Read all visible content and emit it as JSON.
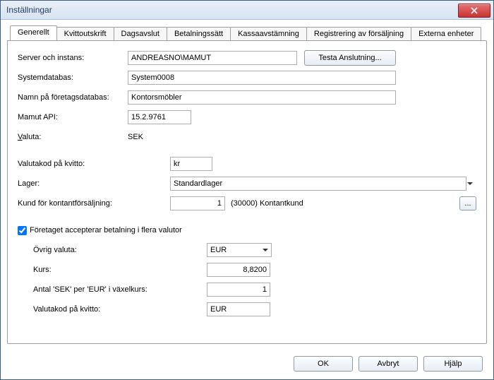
{
  "window": {
    "title": "Inställningar"
  },
  "tabs": [
    {
      "label": "Generellt",
      "active": true
    },
    {
      "label": "Kvittoutskrift"
    },
    {
      "label": "Dagsavslut"
    },
    {
      "label": "Betalningssätt"
    },
    {
      "label": "Kassaavstämning"
    },
    {
      "label": "Registrering av försäljning"
    },
    {
      "label": "Externa enheter"
    }
  ],
  "labels": {
    "server_instance": "Server och instans:",
    "system_database": "Systemdatabas:",
    "company_db_name": "Namn på företagsdatabas:",
    "mamut_api": "Mamut API:",
    "valuta": "Valuta:",
    "valuta_letter": "V",
    "valuta_rest": "aluta:",
    "valutakod_receipt": "Valutakod på kvitto:",
    "lager": "Lager:",
    "cash_sale_customer": "Kund för kontantförsäljning:",
    "multi_currency_checkbox": "Företaget accepterar betalning i flera valutor",
    "other_currency": "Övrig valuta:",
    "rate": "Kurs:",
    "exchange_units": "Antal 'SEK' per 'EUR' i växelkurs:",
    "valutakod_receipt2": "Valutakod på kvitto:"
  },
  "values": {
    "server_instance": "ANDREASNO\\MAMUT",
    "system_database": "System0008",
    "company_db_name": "Kontorsmöbler",
    "mamut_api": "15.2.9761",
    "valuta": "SEK",
    "valutakod_receipt": "kr",
    "lager_selected": "Standardlager",
    "cash_customer_number": "1",
    "cash_customer_name": "(30000) Kontantkund",
    "multi_currency_checked": true,
    "other_currency_selected": "EUR",
    "rate": "8,8200",
    "exchange_units": "1",
    "valutakod_receipt2": "EUR"
  },
  "buttons": {
    "test_connection": "Testa Anslutning...",
    "browse": "...",
    "ok": "OK",
    "cancel": "Avbryt",
    "help_letter": "H",
    "help_rest": "jälp"
  }
}
